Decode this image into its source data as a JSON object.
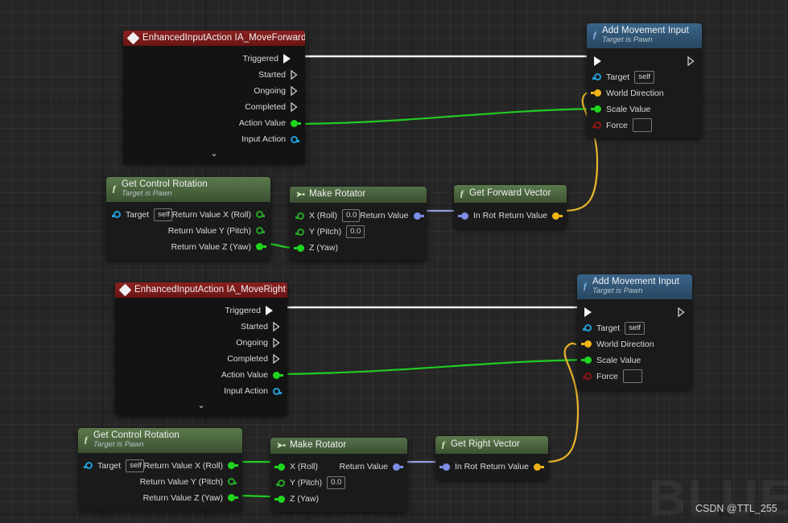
{
  "app": {
    "context": "unreal-blueprint-graph",
    "watermark_text": "BLUEFP",
    "credit_text": "CSDN @TTL_255"
  },
  "colors": {
    "exec_wire": "#f4f4f4",
    "green_wire": "#22cc22",
    "yellow_wire": "#e8b52a",
    "rotator_wire": "#8f9fe0",
    "event_header": "#7b1b1b",
    "function_header": "#2c4a63",
    "pure_header": "#47603c",
    "canvas_bg": "#262626"
  },
  "nodes": [
    {
      "id": "event-move-forward",
      "title": "EnhancedInputAction IA_MoveForward",
      "subtitle": "",
      "icon": "event-diamond-icon",
      "header_kind": "event",
      "outputs": [
        {
          "label": "Triggered",
          "pin": "exec-filled"
        },
        {
          "label": "Started",
          "pin": "exec-hollow"
        },
        {
          "label": "Ongoing",
          "pin": "exec-hollow"
        },
        {
          "label": "Completed",
          "pin": "exec-hollow"
        },
        {
          "label": "Action Value",
          "pin": "filled-green"
        },
        {
          "label": "Input Action",
          "pin": "hollow-blue"
        }
      ],
      "collapse_glyph": "chevron-down-icon"
    },
    {
      "id": "add-movement-input-forward",
      "title": "Add Movement Input",
      "subtitle": "Target is Pawn",
      "icon": "function-f-icon",
      "header_kind": "function",
      "exec_in": "",
      "exec_out": "",
      "inputs": [
        {
          "label": "Target",
          "pin": "hollow-blue",
          "value": "self"
        },
        {
          "label": "World Direction",
          "pin": "filled-yellow",
          "value": ""
        },
        {
          "label": "Scale Value",
          "pin": "filled-green",
          "value": ""
        },
        {
          "label": "Force",
          "pin": "hollow-red",
          "value": ""
        }
      ]
    },
    {
      "id": "get-control-rotation-top",
      "title": "Get Control Rotation",
      "subtitle": "Target is Pawn",
      "icon": "function-f-icon",
      "header_kind": "pure",
      "inputs": [
        {
          "label": "Target",
          "pin": "hollow-blue",
          "value": "self"
        }
      ],
      "outputs": [
        {
          "label": "Return Value X (Roll)",
          "pin": "hollow-green"
        },
        {
          "label": "Return Value Y (Pitch)",
          "pin": "hollow-green"
        },
        {
          "label": "Return Value Z (Yaw)",
          "pin": "filled-green"
        }
      ]
    },
    {
      "id": "make-rotator-top",
      "title": "Make Rotator",
      "subtitle": "",
      "icon": "make-struct-icon",
      "header_kind": "pure",
      "inputs": [
        {
          "label": "X (Roll)",
          "pin": "hollow-green",
          "value": "0.0"
        },
        {
          "label": "Y (Pitch)",
          "pin": "hollow-green",
          "value": "0.0"
        },
        {
          "label": "Z (Yaw)",
          "pin": "filled-green",
          "value": ""
        }
      ],
      "outputs": [
        {
          "label": "Return Value",
          "pin": "filled-blue"
        }
      ]
    },
    {
      "id": "get-forward-vector",
      "title": "Get Forward Vector",
      "subtitle": "",
      "icon": "function-f-icon",
      "header_kind": "pure",
      "inputs": [
        {
          "label": "In Rot",
          "pin": "filled-blue"
        }
      ],
      "outputs": [
        {
          "label": "Return Value",
          "pin": "filled-yellow"
        }
      ]
    },
    {
      "id": "event-move-right",
      "title": "EnhancedInputAction IA_MoveRight",
      "subtitle": "",
      "icon": "event-diamond-icon",
      "header_kind": "event",
      "outputs": [
        {
          "label": "Triggered",
          "pin": "exec-filled"
        },
        {
          "label": "Started",
          "pin": "exec-hollow"
        },
        {
          "label": "Ongoing",
          "pin": "exec-hollow"
        },
        {
          "label": "Completed",
          "pin": "exec-hollow"
        },
        {
          "label": "Action Value",
          "pin": "filled-green"
        },
        {
          "label": "Input Action",
          "pin": "hollow-blue"
        }
      ],
      "collapse_glyph": "chevron-down-icon"
    },
    {
      "id": "add-movement-input-right",
      "title": "Add Movement Input",
      "subtitle": "Target is Pawn",
      "icon": "function-f-icon",
      "header_kind": "function",
      "inputs": [
        {
          "label": "Target",
          "pin": "hollow-blue",
          "value": "self"
        },
        {
          "label": "World Direction",
          "pin": "filled-yellow",
          "value": ""
        },
        {
          "label": "Scale Value",
          "pin": "filled-green",
          "value": ""
        },
        {
          "label": "Force",
          "pin": "hollow-red",
          "value": ""
        }
      ]
    },
    {
      "id": "get-control-rotation-bottom",
      "title": "Get Control Rotation",
      "subtitle": "Target is Pawn",
      "icon": "function-f-icon",
      "header_kind": "pure",
      "inputs": [
        {
          "label": "Target",
          "pin": "hollow-blue",
          "value": "self"
        }
      ],
      "outputs": [
        {
          "label": "Return Value X (Roll)",
          "pin": "filled-green"
        },
        {
          "label": "Return Value Y (Pitch)",
          "pin": "hollow-green"
        },
        {
          "label": "Return Value Z (Yaw)",
          "pin": "filled-green"
        }
      ]
    },
    {
      "id": "make-rotator-bottom",
      "title": "Make Rotator",
      "subtitle": "",
      "icon": "make-struct-icon",
      "header_kind": "pure",
      "inputs": [
        {
          "label": "X (Roll)",
          "pin": "filled-green",
          "value": ""
        },
        {
          "label": "Y (Pitch)",
          "pin": "hollow-green",
          "value": "0.0"
        },
        {
          "label": "Z (Yaw)",
          "pin": "filled-green",
          "value": ""
        }
      ],
      "outputs": [
        {
          "label": "Return Value",
          "pin": "filled-blue"
        }
      ]
    },
    {
      "id": "get-right-vector",
      "title": "Get Right Vector",
      "subtitle": "",
      "icon": "function-f-icon",
      "header_kind": "pure",
      "inputs": [
        {
          "label": "In Rot",
          "pin": "filled-blue"
        }
      ],
      "outputs": [
        {
          "label": "Return Value",
          "pin": "filled-yellow"
        }
      ]
    }
  ],
  "labels": {
    "n0_title": "EnhancedInputAction IA_MoveForward",
    "n0_o0": "Triggered",
    "n0_o1": "Started",
    "n0_o2": "Ongoing",
    "n0_o3": "Completed",
    "n0_o4": "Action Value",
    "n0_o5": "Input Action",
    "n1_title": "Add Movement Input",
    "n1_sub": "Target is Pawn",
    "n1_i0": "Target",
    "n1_i0v": "self",
    "n1_i1": "World Direction",
    "n1_i2": "Scale Value",
    "n1_i3": "Force",
    "n2_title": "Get Control Rotation",
    "n2_sub": "Target is Pawn",
    "n2_i0": "Target",
    "n2_i0v": "self",
    "n2_o0": "Return Value X (Roll)",
    "n2_o1": "Return Value Y (Pitch)",
    "n2_o2": "Return Value Z (Yaw)",
    "n3_title": "Make Rotator",
    "n3_i0": "X (Roll)",
    "n3_i0v": "0.0",
    "n3_i1": "Y (Pitch)",
    "n3_i1v": "0.0",
    "n3_i2": "Z (Yaw)",
    "n3_o0": "Return Value",
    "n4_title": "Get Forward Vector",
    "n4_i0": "In Rot",
    "n4_o0": "Return Value",
    "n5_title": "EnhancedInputAction IA_MoveRight",
    "n5_o0": "Triggered",
    "n5_o1": "Started",
    "n5_o2": "Ongoing",
    "n5_o3": "Completed",
    "n5_o4": "Action Value",
    "n5_o5": "Input Action",
    "n6_title": "Add Movement Input",
    "n6_sub": "Target is Pawn",
    "n6_i0": "Target",
    "n6_i0v": "self",
    "n6_i1": "World Direction",
    "n6_i2": "Scale Value",
    "n6_i3": "Force",
    "n7_title": "Get Control Rotation",
    "n7_sub": "Target is Pawn",
    "n7_i0": "Target",
    "n7_i0v": "self",
    "n7_o0": "Return Value X (Roll)",
    "n7_o1": "Return Value Y (Pitch)",
    "n7_o2": "Return Value Z (Yaw)",
    "n8_title": "Make Rotator",
    "n8_i0": "X (Roll)",
    "n8_i1": "Y (Pitch)",
    "n8_i1v": "0.0",
    "n8_i2": "Z (Yaw)",
    "n8_o0": "Return Value",
    "n9_title": "Get Right Vector",
    "n9_i0": "In Rot",
    "n9_o0": "Return Value",
    "fx": "ƒ",
    "mk": "➤•",
    "chev": "⌄"
  },
  "connections": [
    {
      "from": "event-move-forward.Triggered",
      "to": "add-movement-input-forward.exec",
      "color": "#f4f4f4"
    },
    {
      "from": "event-move-forward.Action Value",
      "to": "add-movement-input-forward.Scale Value",
      "color": "#22cc22"
    },
    {
      "from": "get-control-rotation-top.Return Value Z (Yaw)",
      "to": "make-rotator-top.Z (Yaw)",
      "color": "#22cc22"
    },
    {
      "from": "make-rotator-top.Return Value",
      "to": "get-forward-vector.In Rot",
      "color": "#8f9fe0"
    },
    {
      "from": "get-forward-vector.Return Value",
      "to": "add-movement-input-forward.World Direction",
      "color": "#e8b52a"
    },
    {
      "from": "event-move-right.Triggered",
      "to": "add-movement-input-right.exec",
      "color": "#f4f4f4"
    },
    {
      "from": "event-move-right.Action Value",
      "to": "add-movement-input-right.Scale Value",
      "color": "#22cc22"
    },
    {
      "from": "get-control-rotation-bottom.Return Value X (Roll)",
      "to": "make-rotator-bottom.X (Roll)",
      "color": "#22cc22"
    },
    {
      "from": "get-control-rotation-bottom.Return Value Z (Yaw)",
      "to": "make-rotator-bottom.Z (Yaw)",
      "color": "#22cc22"
    },
    {
      "from": "make-rotator-bottom.Return Value",
      "to": "get-right-vector.In Rot",
      "color": "#8f9fe0"
    },
    {
      "from": "get-right-vector.Return Value",
      "to": "add-movement-input-right.World Direction",
      "color": "#e8b52a"
    }
  ]
}
